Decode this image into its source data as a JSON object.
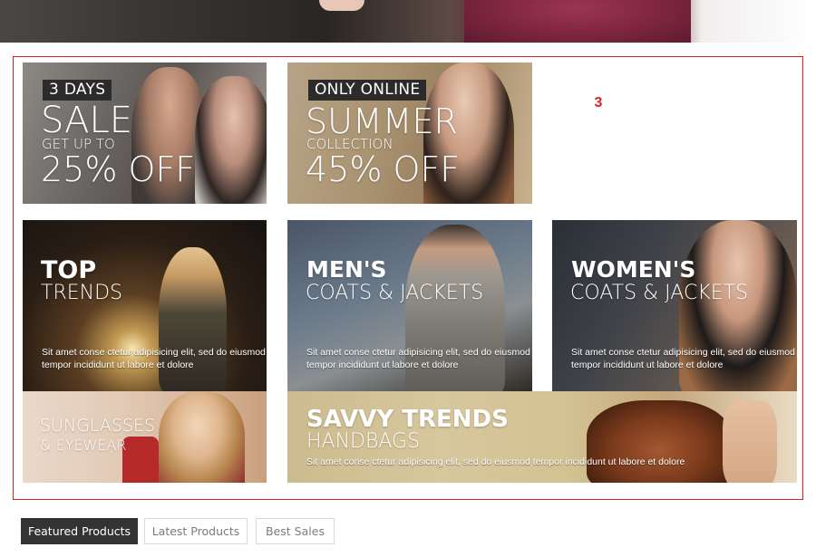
{
  "page": {
    "module_number": "3"
  },
  "banners": {
    "sale": {
      "badge": "3 DAYS",
      "headline": "SALE",
      "subline": "GET UP TO",
      "discount": "25% OFF"
    },
    "summer": {
      "badge": "ONLY ONLINE",
      "headline": "SUMMER",
      "subline": "COLLECTION",
      "discount": "45% OFF"
    },
    "top_trends": {
      "headline": "TOP",
      "subline": "TRENDS",
      "description_line1": "Sit amet conse ctetur adipisicing elit, sed do eiusmod",
      "description_line2": "tempor incididunt ut labore et dolore"
    },
    "mens": {
      "headline": "MEN'S",
      "subline": "COATS & JACKETS",
      "description_line1": "Sit amet conse ctetur adipisicing elit, sed do eiusmod",
      "description_line2": "tempor incididunt ut labore et dolore"
    },
    "womens": {
      "headline": "WOMEN'S",
      "subline": "COATS & JACKETS",
      "description_line1": "Sit amet conse ctetur adipisicing elit, sed do eiusmod",
      "description_line2": "tempor incididunt ut labore et dolore"
    },
    "sunglasses": {
      "headline": "SUNGLASSES",
      "subline": "& EYEWEAR"
    },
    "handbags": {
      "headline": "SAVVY TRENDS",
      "subline": "HANDBAGS",
      "description": "Sit amet conse ctetur adipisicing elit, sed do eiusmod tempor incididunt ut labore et dolore"
    }
  },
  "tabs": [
    {
      "label": "Featured Products",
      "active": true
    },
    {
      "label": "Latest Products",
      "active": false
    },
    {
      "label": "Best Sales",
      "active": false
    }
  ],
  "colors": {
    "accent_red": "#e02020",
    "tab_active_bg": "#333333",
    "tab_border": "#d9d9d9"
  }
}
